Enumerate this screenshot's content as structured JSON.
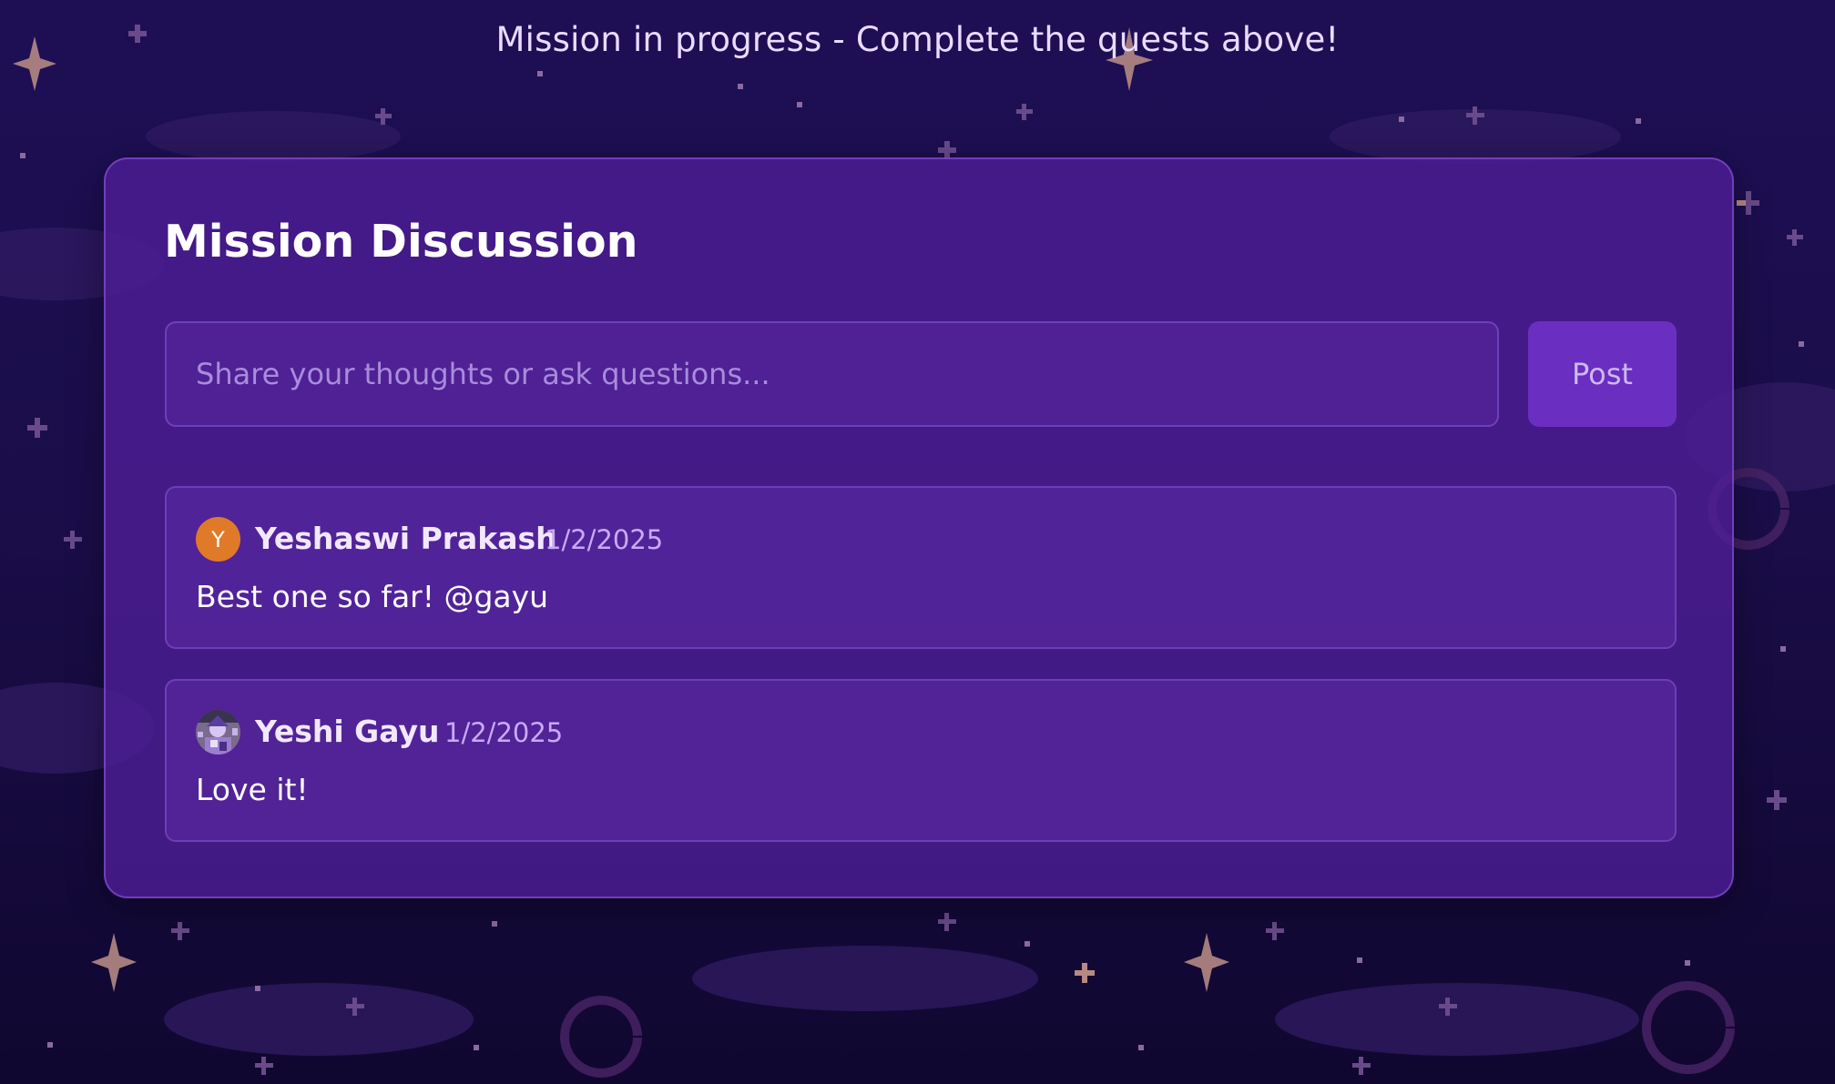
{
  "header": {
    "status_text": "Mission in progress - Complete the quests above!"
  },
  "discussion": {
    "title": "Mission Discussion",
    "input_placeholder": "Share your thoughts or ask questions...",
    "post_label": "Post",
    "comments": [
      {
        "author": "Yeshaswi Prakash",
        "date": "1/2/2025",
        "text": "Best one so far! @gayu",
        "avatar_initial": "Y",
        "avatar_color": "#e07a28"
      },
      {
        "author": "Yeshi Gayu",
        "date": "1/2/2025",
        "text": "Love it!",
        "avatar_icon": "profile-photo-icon"
      }
    ]
  },
  "colors": {
    "background": "#150b3c",
    "panel": "#4e1e96",
    "button": "#6a2fc0",
    "date_text": "#c9a9f7",
    "star": "#b58a84"
  }
}
